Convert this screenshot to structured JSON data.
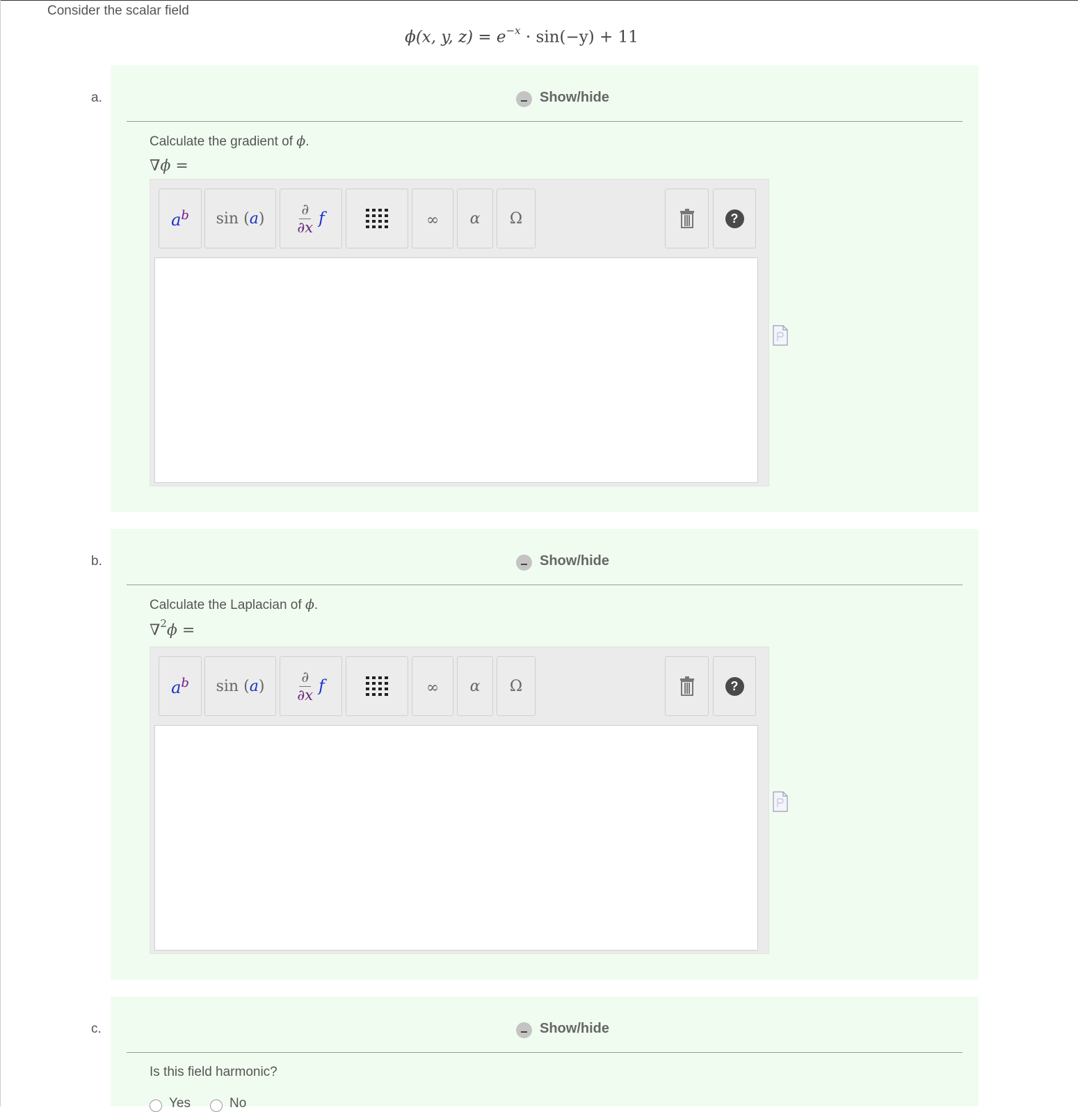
{
  "intro": "Consider the scalar field",
  "formula": {
    "lhs": "ϕ(x, y, z) = e",
    "exponent": "−x",
    "rhs": " · sin(−y) + 11"
  },
  "parts": [
    {
      "letter": "a.",
      "show_hide": "Show/hide",
      "prompt_text": "Calculate the gradient of ",
      "prompt_symbol": "ϕ",
      "prompt_end": ".",
      "lhs_main": "∇ϕ =",
      "lhs_sup": ""
    },
    {
      "letter": "b.",
      "show_hide": "Show/hide",
      "prompt_text": "Calculate the Laplacian of ",
      "prompt_symbol": "ϕ",
      "prompt_end": ".",
      "lhs_pre": "∇",
      "lhs_sup": "2",
      "lhs_post": "ϕ ="
    },
    {
      "letter": "c.",
      "show_hide": "Show/hide",
      "prompt_text": "Is this field harmonic?",
      "options": [
        "Yes",
        "No"
      ]
    }
  ],
  "toolbar": {
    "power_base": "a",
    "power_exp": "b",
    "sin_fn": "sin",
    "sin_open": "(",
    "sin_arg": "a",
    "sin_close": ")",
    "deriv_num": "∂",
    "deriv_den": "∂x",
    "deriv_fn": "f",
    "infinity": "∞",
    "alpha": "α",
    "omega": "Ω",
    "help": "?"
  },
  "icons": {
    "show_hide": "minus-circle-icon",
    "matrix": "matrix-icon",
    "trash": "trash-icon",
    "help": "help-icon",
    "document": "document-icon"
  }
}
